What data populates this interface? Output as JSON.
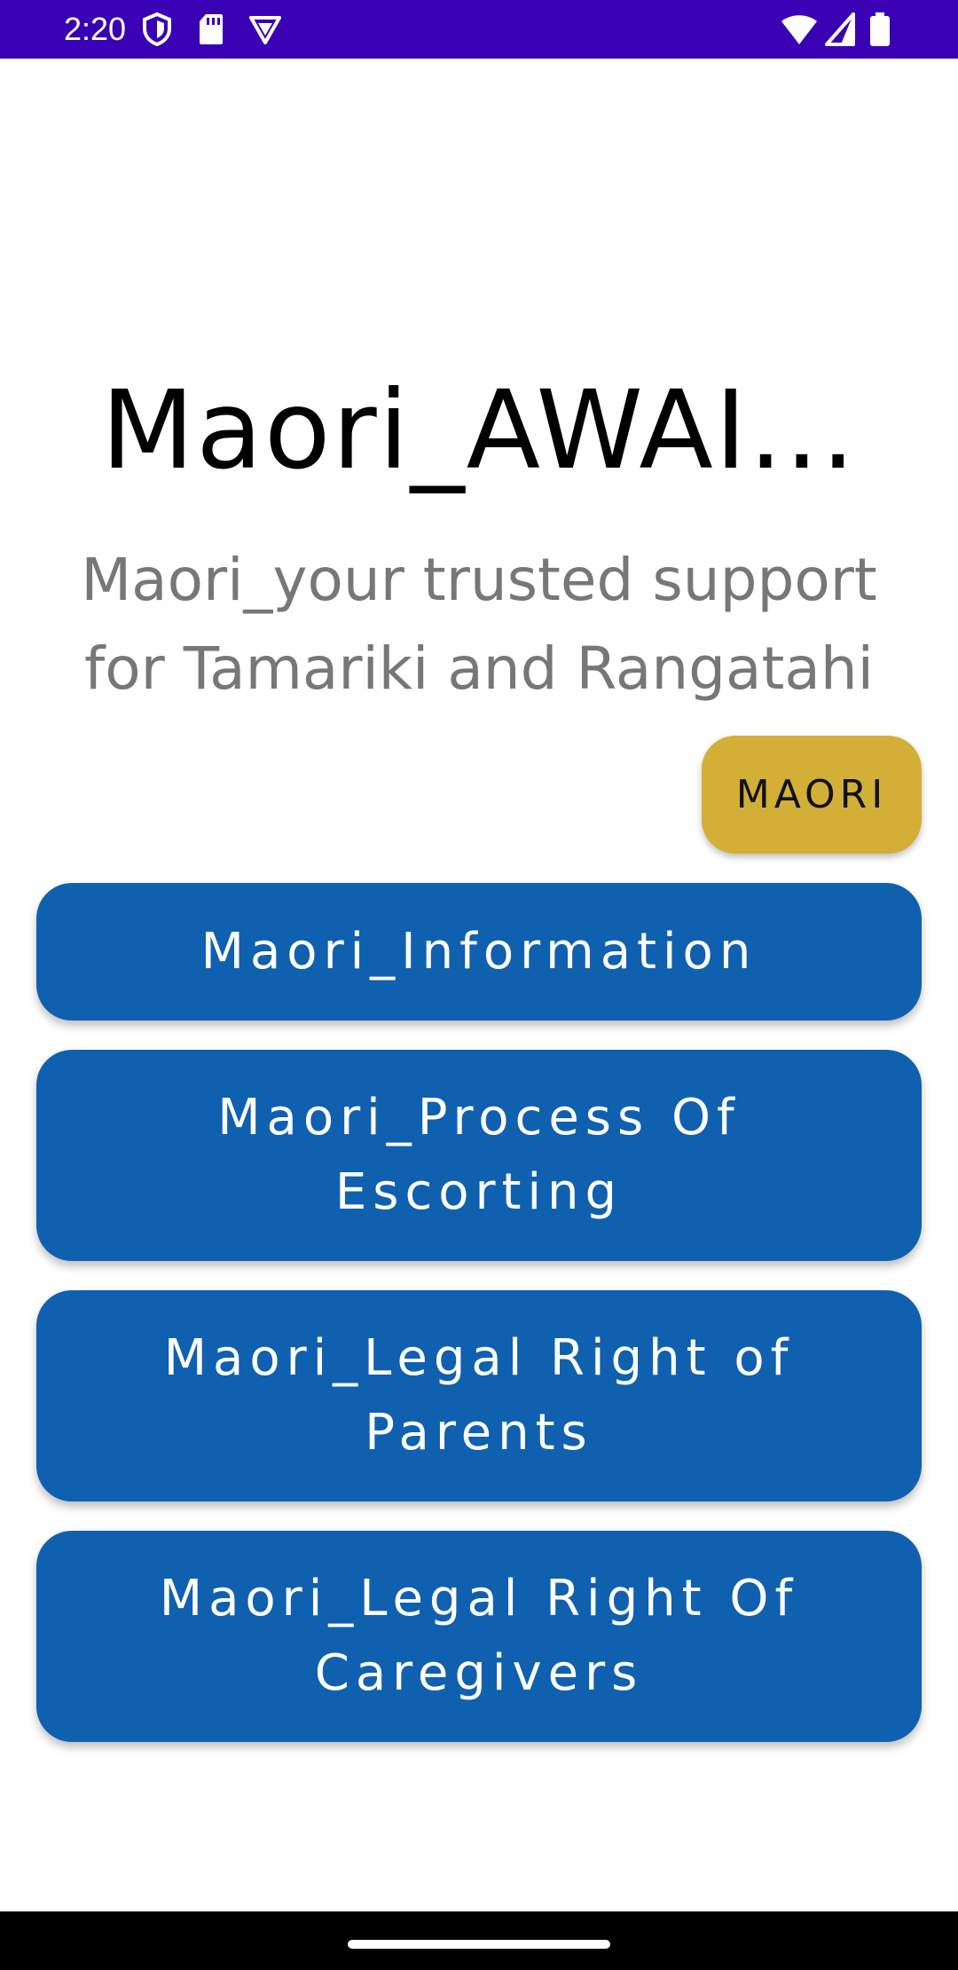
{
  "status_bar": {
    "time": "2:20",
    "icons_left": [
      "shield-icon",
      "sd-card-icon",
      "vpn-icon"
    ],
    "icons_right": [
      "wifi-icon",
      "cell-signal-icon",
      "battery-icon"
    ],
    "background": "#3a00b3"
  },
  "header": {
    "title": "Maori_AWAI...",
    "subtitle": "Maori_your trusted support for Tamariki and Rangatahi"
  },
  "language_toggle": {
    "label": "MAORI",
    "color": "#d4af37"
  },
  "menu": {
    "color": "#1060b0",
    "items": [
      {
        "label": "Maori_Information"
      },
      {
        "label": "Maori_Process Of Escorting"
      },
      {
        "label": "Maori_Legal Right of Parents"
      },
      {
        "label": "Maori_Legal Right Of Caregivers"
      }
    ]
  }
}
